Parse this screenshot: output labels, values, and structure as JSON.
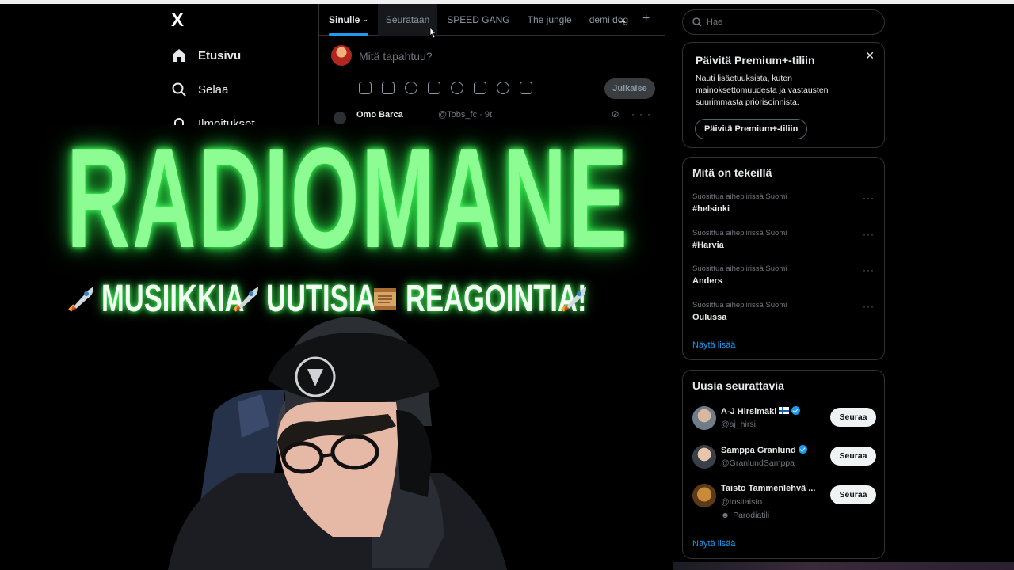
{
  "sidebar": {
    "logo": "X",
    "items": [
      {
        "label": "Etusivu",
        "icon": "home-icon"
      },
      {
        "label": "Selaa",
        "icon": "search-icon"
      },
      {
        "label": "Ilmoitukset",
        "icon": "bell-icon"
      }
    ]
  },
  "tabs": [
    {
      "label": "Sinulle",
      "active": true
    },
    {
      "label": "Seurataan"
    },
    {
      "label": "SPEED GANG"
    },
    {
      "label": "The jungle"
    },
    {
      "label": "demi dog"
    }
  ],
  "compose": {
    "placeholder": "Mitä tapahtuu?",
    "publish_label": "Julkaise"
  },
  "post": {
    "name": "Omo Barca",
    "meta": "@Tobs_fc · 9t"
  },
  "overlay": {
    "title": "RADIOMANE",
    "words": [
      "MUSIIKKIA",
      "UUTISIA",
      "REAGOINTIA!"
    ],
    "glow_color": "#8dfc92"
  },
  "search": {
    "placeholder": "Hae"
  },
  "premium": {
    "title": "Päivitä Premium+-tiliin",
    "body": "Nauti lisäetuuksista, kuten mainoksettomuudesta ja vastausten suurimmasta priorisoinnista.",
    "button": "Päivitä Premium+-tiliin"
  },
  "trends": {
    "title": "Mitä on tekeillä",
    "items": [
      {
        "context": "Suosittua aihepiirissä Suomi",
        "name": "#helsinki"
      },
      {
        "context": "Suosittua aihepiirissä Suomi",
        "name": "#Harvia"
      },
      {
        "context": "Suosittua aihepiirissä Suomi",
        "name": "Anders"
      },
      {
        "context": "Suosittua aihepiirissä Suomi",
        "name": "Oulussa"
      }
    ],
    "more": "Näytä lisää"
  },
  "follow": {
    "title": "Uusia seurattavia",
    "users": [
      {
        "name": "A-J Hirsimäki",
        "handle": "@aj_hirsi",
        "button": "Seuraa"
      },
      {
        "name": "Samppa Granlund",
        "handle": "@GranlundSamppa",
        "button": "Seuraa"
      },
      {
        "name": "Taisto Tammenlehvä ...",
        "handle": "@tositaisto",
        "extra": "Parodiatili",
        "button": "Seuraa"
      }
    ],
    "more": "Näytä lisää"
  },
  "colors": {
    "accent": "#1d9bf0",
    "background": "#000000",
    "border": "#2f3336"
  }
}
